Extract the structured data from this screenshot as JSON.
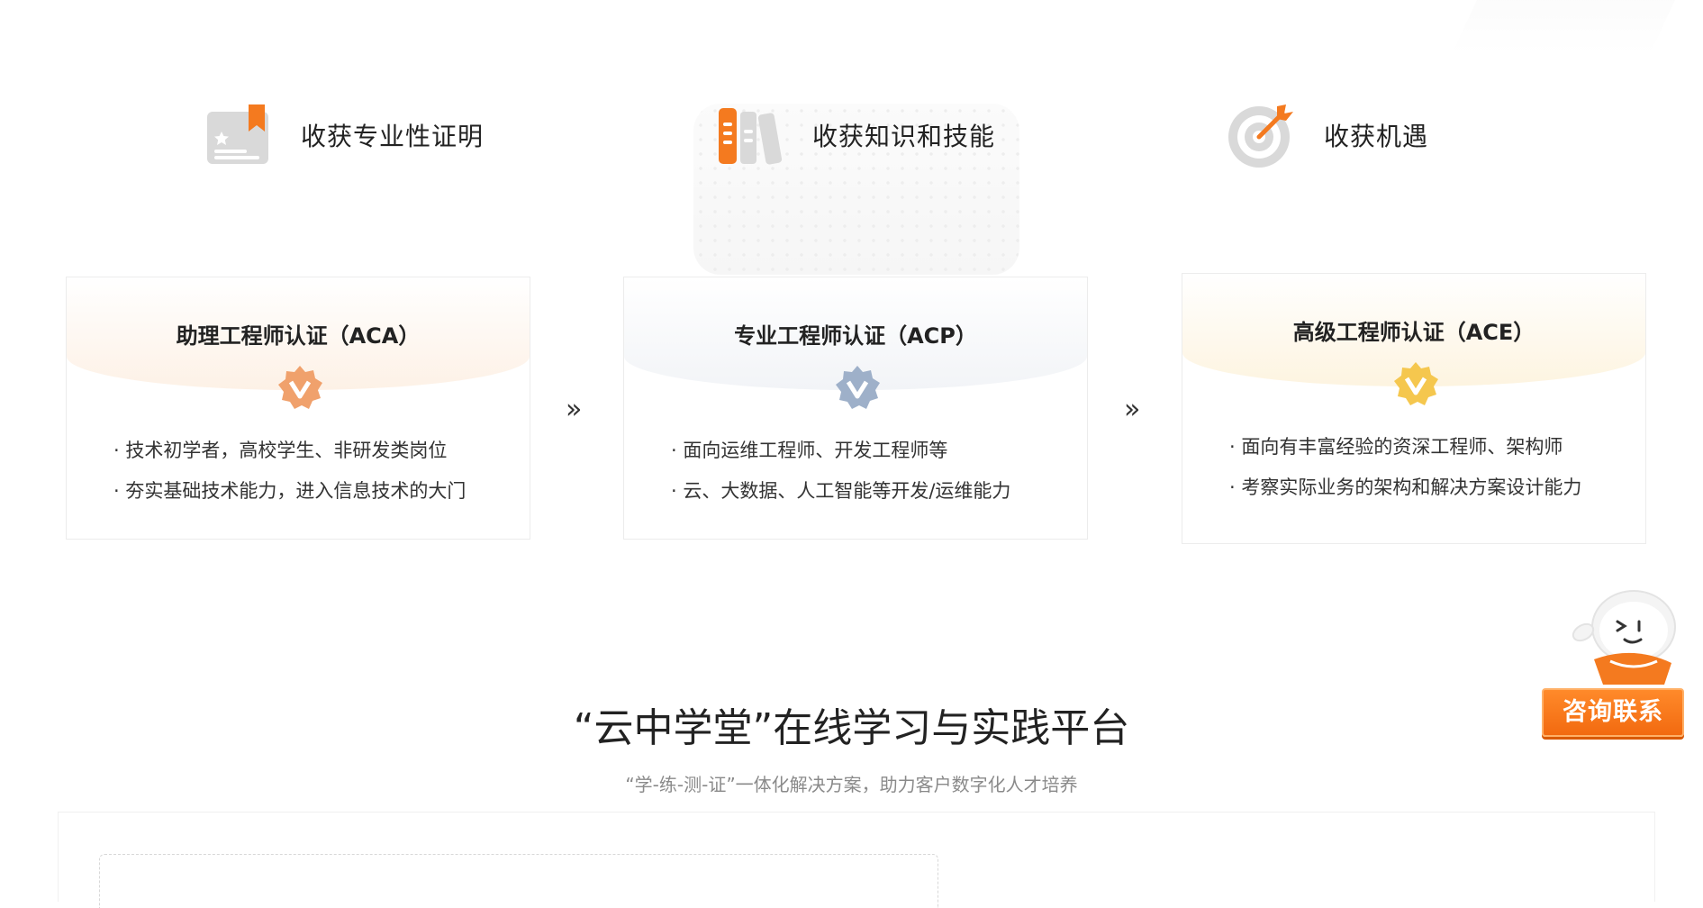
{
  "benefits": [
    {
      "icon": "certificate-icon",
      "label": "收获专业性证明"
    },
    {
      "icon": "books-icon",
      "label": "收获知识和技能"
    },
    {
      "icon": "target-icon",
      "label": "收获机遇"
    }
  ],
  "cards": [
    {
      "title": "助理工程师认证（ACA）",
      "badge_icon": "aca-badge-icon",
      "badge_color": "#f0a16c",
      "glow_color": "#fdf1e6",
      "points": [
        "· 技术初学者，高校学生、非研发类岗位",
        "· 夯实基础技术能力，进入信息技术的大门"
      ]
    },
    {
      "title": "专业工程师认证（ACP）",
      "badge_icon": "acp-badge-icon",
      "badge_color": "#9eb0c9",
      "glow_color": "#f2f4f7",
      "points": [
        "· 面向运维工程师、开发工程师等",
        "· 云、大数据、人工智能等开发/运维能力"
      ]
    },
    {
      "title": "高级工程师认证（ACE）",
      "badge_icon": "ace-badge-icon",
      "badge_color": "#f5c74e",
      "glow_color": "#fdf4e0",
      "points": [
        "· 面向有丰富经验的资深工程师、架构师",
        "· 考察实际业务的架构和解决方案设计能力"
      ]
    }
  ],
  "arrows": [
    "»",
    "»"
  ],
  "section": {
    "title": "“云中学堂”在线学习与实践平台",
    "subtitle": "“学-练-测-证”一体化解决方案，助力客户数字化人才培养"
  },
  "consult": {
    "label": "咨询联系",
    "accent": "#f47a1f"
  },
  "colors": {
    "accent_orange": "#f47a1f",
    "icon_gray": "#d9d9d9"
  }
}
